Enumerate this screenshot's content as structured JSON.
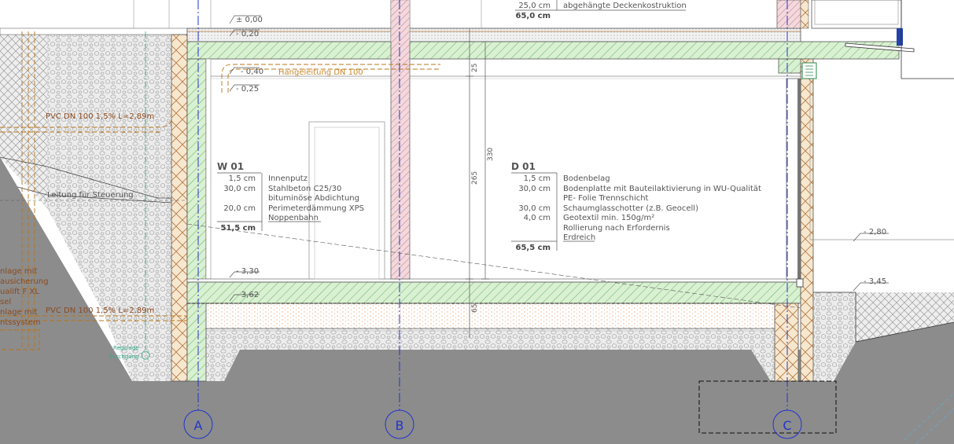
{
  "drawing": {
    "levels": {
      "pm0": "± 0,00",
      "m020": "- 0,20",
      "m040": "- 0,40",
      "m025": "- 0,25",
      "m330": "- 3,30",
      "m362": "- 3,62",
      "m280": "- 2,80",
      "m345": "- 3,45"
    },
    "pipes": {
      "hangeleitung": "Hängeleitung DN 100",
      "pvc_upper": "PVC DN 100 1,5% L=2,89m",
      "pvc_lower": "PVC DN 100 1,5% L=2,89m",
      "leitung": "Leitung für Steuerung"
    },
    "left_legend": [
      "nlage mit",
      "ausicherung",
      "ualift F XL",
      "sel",
      "nlage mit",
      "ntssystem"
    ],
    "left_small": [
      "Regulage",
      "Durchgang"
    ],
    "dims": {
      "d25": "25",
      "d330": "330",
      "d265": "265",
      "d65": "65"
    },
    "ceiling_rows": [
      {
        "thick": "25,0 cm",
        "desc": "abgehängte Deckenkostruktion"
      },
      {
        "thick": "65,0 cm",
        "desc": ""
      }
    ],
    "w01": {
      "title": "W 01",
      "rows": [
        {
          "thick": "1,5 cm",
          "desc": "Innenputz"
        },
        {
          "thick": "30,0 cm",
          "desc": "Stahlbeton C25/30"
        },
        {
          "thick": "",
          "desc": "bituminöse Abdichtung"
        },
        {
          "thick": "20,0 cm",
          "desc": "Perimeterdämmung XPS"
        },
        {
          "thick": "",
          "desc": "Noppenbahn"
        }
      ],
      "total": "51,5 cm"
    },
    "d01": {
      "title": "D 01",
      "rows": [
        {
          "thick": "1,5 cm",
          "desc": "Bodenbelag"
        },
        {
          "thick": "30,0 cm",
          "desc": "Bodenplatte mit Bauteilaktivierung in WU-Qualität"
        },
        {
          "thick": "",
          "desc": "PE- Folie Trennschicht"
        },
        {
          "thick": "30,0 cm",
          "desc": "Schaumglasschotter (z.B. Geocell)"
        },
        {
          "thick": "4,0 cm",
          "desc": "Geotextil min. 150g/m²"
        },
        {
          "thick": "",
          "desc": "Rollierung nach Erfordernis"
        },
        {
          "thick": "",
          "desc": "Erdreich"
        }
      ],
      "total": "65,5 cm"
    },
    "axes": [
      "A",
      "B",
      "C"
    ],
    "colors": {
      "concrete_green": "#d9f0d2",
      "hatch_green": "#62b15a",
      "insulation": "#f6e7cf",
      "insulation_stroke": "#b5763e",
      "ground_dark": "#8c8c8c",
      "gravel_bg": "#ececec",
      "axis_blue": "#2233cc",
      "pipe_orange": "#b8741a",
      "pipe_brown": "#8a4a20",
      "column_pink": "#f3d9dd",
      "text_gray": "#555555"
    }
  }
}
